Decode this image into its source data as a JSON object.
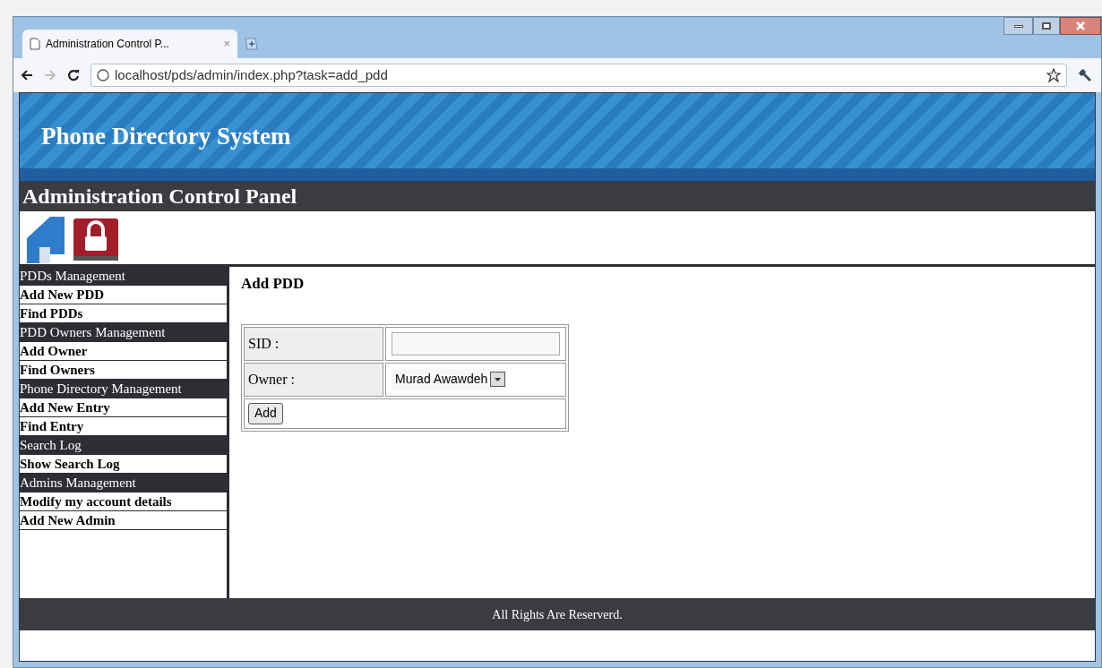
{
  "browser": {
    "tab": {
      "title": "Administration Control P...",
      "close": "×"
    },
    "url": "localhost/pds/admin/index.php?task=add_pdd"
  },
  "header": {
    "title": "Phone Directory System",
    "subtitle": "Administration Control Panel"
  },
  "sidebar": [
    {
      "title": "PDDs Management",
      "items": [
        "Add New PDD",
        "Find PDDs"
      ]
    },
    {
      "title": "PDD Owners Management",
      "items": [
        "Add Owner",
        "Find Owners"
      ]
    },
    {
      "title": "Phone Directory Management",
      "items": [
        "Add New Entry",
        "Find Entry"
      ]
    },
    {
      "title": "Search Log",
      "items": [
        "Show Search Log"
      ]
    },
    {
      "title": "Admins Management",
      "items": [
        "Modify my account details",
        "Add New Admin"
      ]
    }
  ],
  "content": {
    "heading": "Add PDD",
    "fields": [
      {
        "kind": "text",
        "label": "SID :"
      },
      {
        "kind": "select",
        "label": "Owner :",
        "value": "Murad Awawdeh"
      }
    ],
    "submit": "Add"
  },
  "footer": "All Rights Are Reserverd."
}
